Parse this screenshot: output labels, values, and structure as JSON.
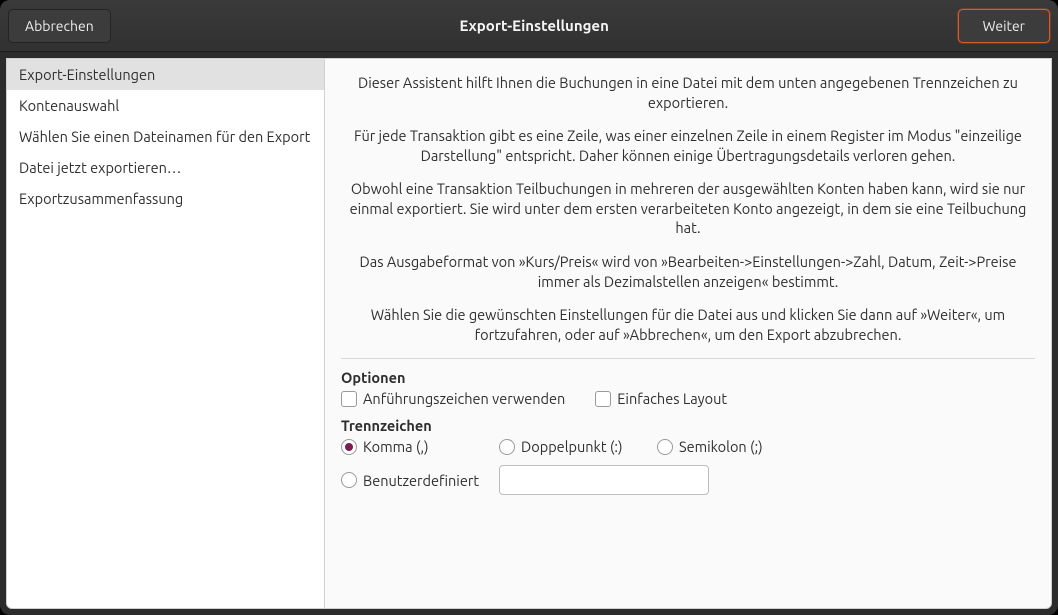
{
  "titlebar": {
    "cancel_label": "Abbrechen",
    "title": "Export-Einstellungen",
    "next_label": "Weiter"
  },
  "sidebar": {
    "items": [
      {
        "label": "Export-Einstellungen",
        "active": true
      },
      {
        "label": "Kontenauswahl",
        "active": false
      },
      {
        "label": "Wählen Sie einen Dateinamen für den Export",
        "active": false
      },
      {
        "label": "Datei jetzt exportieren…",
        "active": false
      },
      {
        "label": "Exportzusammenfassung",
        "active": false
      }
    ]
  },
  "description": {
    "p1": "Dieser Assistent hilft Ihnen die Buchungen in eine Datei mit dem unten angegebenen Trennzeichen zu exportieren.",
    "p2": "Für jede Transaktion gibt es eine Zeile, was einer einzelnen Zeile in einem Register im Modus \"einzeilige Darstellung\" entspricht. Daher können einige Übertragungsdetails verloren gehen.",
    "p3": "Obwohl eine Transaktion Teilbuchungen in mehreren der ausgewählten Konten haben kann, wird sie nur einmal exportiert. Sie wird unter dem ersten verarbeiteten Konto angezeigt, in dem sie eine Teilbuchung hat.",
    "p4": "Das Ausgabeformat von »Kurs/Preis« wird von »Bearbeiten->Einstellungen->Zahl, Datum, Zeit->Preise immer als Dezimalstellen anzeigen« bestimmt.",
    "p5": "Wählen Sie die gewünschten Einstellungen für die Datei aus und klicken Sie dann auf »Weiter«, um fortzufahren, oder auf »Abbrechen«, um den Export abzubrechen."
  },
  "options": {
    "heading": "Optionen",
    "use_quotes_label": "Anführungszeichen verwenden",
    "use_quotes_checked": false,
    "simple_layout_label": "Einfaches Layout",
    "simple_layout_checked": false
  },
  "separator": {
    "heading": "Trennzeichen",
    "comma_label": "Komma (,)",
    "colon_label": "Doppelpunkt (:)",
    "semicolon_label": "Semikolon (;)",
    "custom_label": "Benutzerdefiniert",
    "selected": "comma",
    "custom_value": ""
  }
}
